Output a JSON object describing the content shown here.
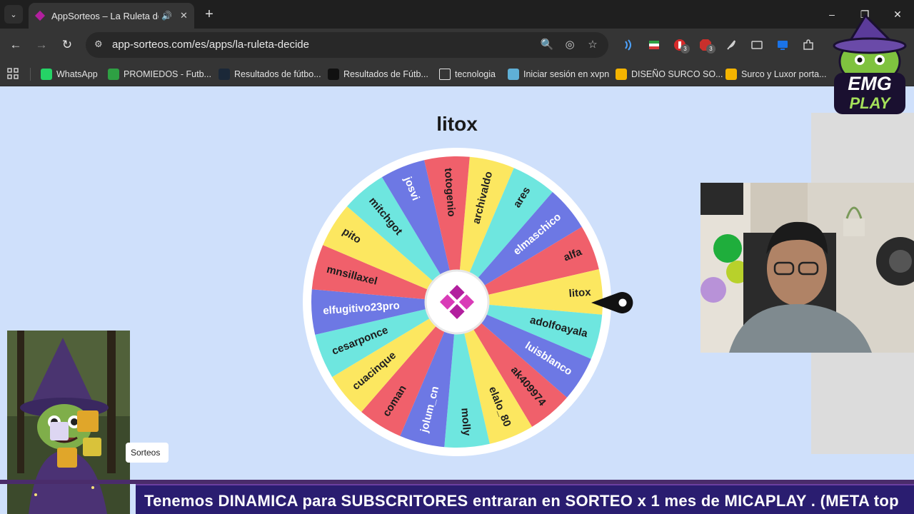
{
  "browser": {
    "tab": {
      "title": "AppSorteos – La Ruleta de l",
      "close_glyph": "✕",
      "audio_glyph": "🔊"
    },
    "new_tab_glyph": "+",
    "tab_menu_glyph": "⌄",
    "window_controls": {
      "minimize": "–",
      "restore": "❐",
      "close": "✕"
    },
    "nav": {
      "back": "←",
      "forward": "→",
      "reload": "↻"
    },
    "url": "app-sorteos.com/es/apps/la-ruleta-decide",
    "omnibox_icons": {
      "site_info": "⚙",
      "zoom": "🔍",
      "eye_off": "◎",
      "star": "☆"
    }
  },
  "bookmarks": [
    {
      "label": "WhatsApp",
      "icon": "whatsapp-icon",
      "color": "#25d366"
    },
    {
      "label": "PROMIEDOS - Futb...",
      "icon": "promiedos-icon",
      "color": "#2ea043"
    },
    {
      "label": "Resultados de fútbo...",
      "icon": "results-icon",
      "color": "#1b2838"
    },
    {
      "label": "Resultados de Fútb...",
      "icon": "results-2-icon",
      "color": "#111111"
    },
    {
      "label": "tecnologia",
      "icon": "folder-icon",
      "color": "#e3e3e3"
    },
    {
      "label": "Iniciar sesión en xvpn",
      "icon": "xvpn-icon",
      "color": "#5fb0d6"
    },
    {
      "label": "DISEÑO SURCO SO...",
      "icon": "slides-icon",
      "color": "#f4b400"
    },
    {
      "label": "Surco y Luxor porta...",
      "icon": "slides-2-icon",
      "color": "#f4b400"
    }
  ],
  "extensions": {
    "badges": [
      "3",
      "3"
    ],
    "icons": [
      "wifi-icon",
      "extension-flag-icon",
      "extension-red-icon",
      "extension-abp-icon",
      "feather-icon",
      "cast-icon",
      "screen-icon",
      "puzzle-icon"
    ]
  },
  "page": {
    "winner": "litox",
    "wheel": {
      "names": [
        "archivaldo",
        "ares",
        "elmaschico",
        "alfa",
        "litox",
        "adolfoayala",
        "luisblanco",
        "ak409974",
        "elalo_80",
        "molly",
        "jolum_cn",
        "coman",
        "cuacinque",
        "cesarponce",
        "elfugitivo23pro",
        "mnsillaxel",
        "pito",
        "mitchgot",
        "josvi",
        "totogenio"
      ],
      "colors": [
        "#fce760",
        "#6ee6df",
        "#6d78e4",
        "#f0606b"
      ],
      "hub_color": "#b21f9e"
    }
  },
  "overlay": {
    "sorteos_chip": "Sorteos",
    "logo": {
      "line1": "EMG",
      "line2": "PLAY"
    },
    "ticker": "Tenemos DINAMICA para SUBSCRITORES entraran en SORTEO x 1 mes de MICAPLAY .  (META  top"
  }
}
